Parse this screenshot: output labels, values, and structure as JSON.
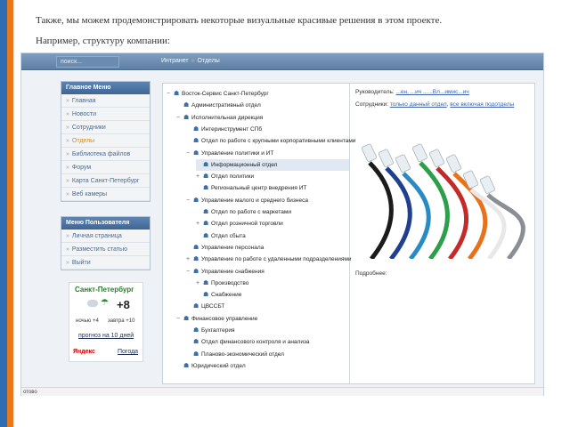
{
  "slide": {
    "line1": "Также, мы можем продемонстрировать некоторые визуальные красивые решения в этом проекте.",
    "line2": "Например, структуру компании:"
  },
  "browser": {
    "search_placeholder": "поиск...",
    "breadcrumb": {
      "root": "Интранет",
      "separator": "»",
      "current": "Отделы"
    },
    "status_text": "отово"
  },
  "main_menu": {
    "title": "Главное Меню",
    "items": [
      {
        "label": "Главная",
        "active": false
      },
      {
        "label": "Новости",
        "active": false
      },
      {
        "label": "Сотрудники",
        "active": false
      },
      {
        "label": "Отделы",
        "active": true
      },
      {
        "label": "Библиотека файлов",
        "active": false
      },
      {
        "label": "Форум",
        "active": false
      },
      {
        "label": "Карта Санкт-Петербург",
        "active": false
      },
      {
        "label": "Веб камеры",
        "active": false
      }
    ]
  },
  "user_menu": {
    "title": "Меню Пользователя",
    "items": [
      {
        "label": "Личная страница"
      },
      {
        "label": "Разместить статью"
      },
      {
        "label": "Выйти"
      }
    ]
  },
  "weather": {
    "city": "Санкт-Петербург",
    "temp": "+8",
    "night": "ночью +4",
    "tomorrow": "завтра +10",
    "forecast_link": "прогноз на 10 дней",
    "brand": "Яндекс",
    "pogoda_link": "Погода"
  },
  "tree": [
    {
      "label": "Восток-Сервис Санкт-Петербург",
      "level": 0,
      "toggle": "−",
      "icon": "group-icon",
      "selected": false
    },
    {
      "label": "Административный отдел",
      "level": 1,
      "toggle": "",
      "icon": "group-icon",
      "selected": false
    },
    {
      "label": "Исполнительная дирекция",
      "level": 1,
      "toggle": "−",
      "icon": "group-icon",
      "selected": false
    },
    {
      "label": "Интеринструмент СПб",
      "level": 2,
      "toggle": "",
      "icon": "group-icon",
      "selected": false
    },
    {
      "label": "Отдел по работе с крупными корпоративными клиентами",
      "level": 2,
      "toggle": "",
      "icon": "group-icon",
      "selected": false
    },
    {
      "label": "Управление политики и ИТ",
      "level": 2,
      "toggle": "−",
      "icon": "group-icon",
      "selected": false
    },
    {
      "label": "Информационный отдел",
      "level": 3,
      "toggle": "",
      "icon": "group-icon",
      "selected": true
    },
    {
      "label": "Отдел политики",
      "level": 3,
      "toggle": "+",
      "icon": "group-icon",
      "selected": false
    },
    {
      "label": "Региональный центр внедрения ИТ",
      "level": 3,
      "toggle": "",
      "icon": "group-icon",
      "selected": false
    },
    {
      "label": "Управление малого и среднего бизнеса",
      "level": 2,
      "toggle": "−",
      "icon": "group-icon",
      "selected": false
    },
    {
      "label": "Отдел по работе с маркетами",
      "level": 3,
      "toggle": "",
      "icon": "group-icon",
      "selected": false
    },
    {
      "label": "Отдел розничной торговли",
      "level": 3,
      "toggle": "+",
      "icon": "group-icon",
      "selected": false
    },
    {
      "label": "Отдел сбыта",
      "level": 3,
      "toggle": "",
      "icon": "group-icon",
      "selected": false
    },
    {
      "label": "Управление персонала",
      "level": 2,
      "toggle": "",
      "icon": "group-icon",
      "selected": false
    },
    {
      "label": "Управление по работе с удаленными подразделениями",
      "level": 2,
      "toggle": "+",
      "icon": "group-icon",
      "selected": false
    },
    {
      "label": "Управление снабжения",
      "level": 2,
      "toggle": "−",
      "icon": "group-icon",
      "selected": false
    },
    {
      "label": "Производство",
      "level": 3,
      "toggle": "+",
      "icon": "group-icon",
      "selected": false
    },
    {
      "label": "Снабжение",
      "level": 3,
      "toggle": "",
      "icon": "group-icon",
      "selected": false
    },
    {
      "label": "ЦВССБТ",
      "level": 2,
      "toggle": "",
      "icon": "group-icon",
      "selected": false
    },
    {
      "label": "Финансовое управление",
      "level": 1,
      "toggle": "−",
      "icon": "group-icon",
      "selected": false
    },
    {
      "label": "Бухгалтерия",
      "level": 2,
      "toggle": "",
      "icon": "group-icon",
      "selected": false
    },
    {
      "label": "Отдел финансового контроля и анализа",
      "level": 2,
      "toggle": "",
      "icon": "group-icon",
      "selected": false
    },
    {
      "label": "Планово-экономический отдел",
      "level": 2,
      "toggle": "",
      "icon": "group-icon",
      "selected": false
    },
    {
      "label": "Юридический отдел",
      "level": 1,
      "toggle": "",
      "icon": "group-icon",
      "selected": false
    }
  ],
  "info": {
    "head_label": "Руководитель:",
    "head_value": "...ен, ...ич ......Вл...имис...ич",
    "staff_label": "Сотрудники:",
    "staff_link1": "только данный отдел",
    "staff_link2": "все включая подотделы",
    "more_label": "Подробнее:",
    "cable_colors": [
      "#1b1b1b",
      "#1f3f8f",
      "#2a8ac4",
      "#2d9e4a",
      "#c42a2a",
      "#e6731c",
      "#e8e8e8",
      "#8a8f96"
    ]
  }
}
